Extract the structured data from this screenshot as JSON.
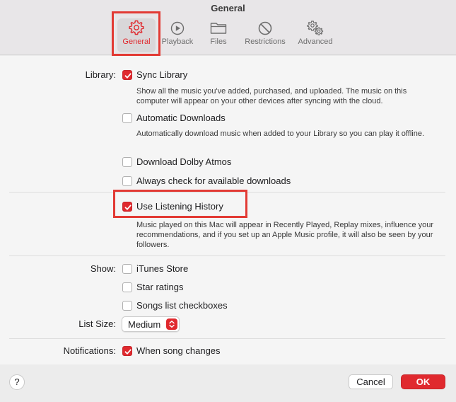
{
  "window": {
    "title": "General"
  },
  "tabs": [
    {
      "label": "General",
      "icon": "gear-icon",
      "active": true
    },
    {
      "label": "Playback",
      "icon": "play-circle-icon",
      "active": false
    },
    {
      "label": "Files",
      "icon": "folder-icon",
      "active": false
    },
    {
      "label": "Restrictions",
      "icon": "restrictions-icon",
      "active": false
    },
    {
      "label": "Advanced",
      "icon": "gears-icon",
      "active": false
    }
  ],
  "library": {
    "label": "Library:",
    "sync_library": {
      "label": "Sync Library",
      "checked": true,
      "description": "Show all the music you've added, purchased, and uploaded. The music on this computer will appear on your other devices after syncing with the cloud."
    },
    "automatic_downloads": {
      "label": "Automatic Downloads",
      "checked": false,
      "description": "Automatically download music when added to your Library so you can play it offline."
    },
    "dolby_atmos": {
      "label": "Download Dolby Atmos",
      "checked": false
    },
    "check_downloads": {
      "label": "Always check for available downloads",
      "checked": false
    }
  },
  "listening_history": {
    "label": "Use Listening History",
    "checked": true,
    "description": "Music played on this Mac will appear in Recently Played, Replay mixes, influence your recommendations, and if you set up an Apple Music profile, it will also be seen by your followers."
  },
  "show": {
    "label": "Show:",
    "itunes_store": {
      "label": "iTunes Store",
      "checked": false
    },
    "star_ratings": {
      "label": "Star ratings",
      "checked": false
    },
    "songs_list_checkboxes": {
      "label": "Songs list checkboxes",
      "checked": false
    }
  },
  "list_size": {
    "label": "List Size:",
    "value": "Medium"
  },
  "notifications": {
    "label": "Notifications:",
    "when_song_changes": {
      "label": "When song changes",
      "checked": true
    }
  },
  "footer": {
    "help_label": "?",
    "cancel_label": "Cancel",
    "ok_label": "OK"
  },
  "colors": {
    "accent": "#e0292e",
    "highlight": "#e23a34"
  }
}
